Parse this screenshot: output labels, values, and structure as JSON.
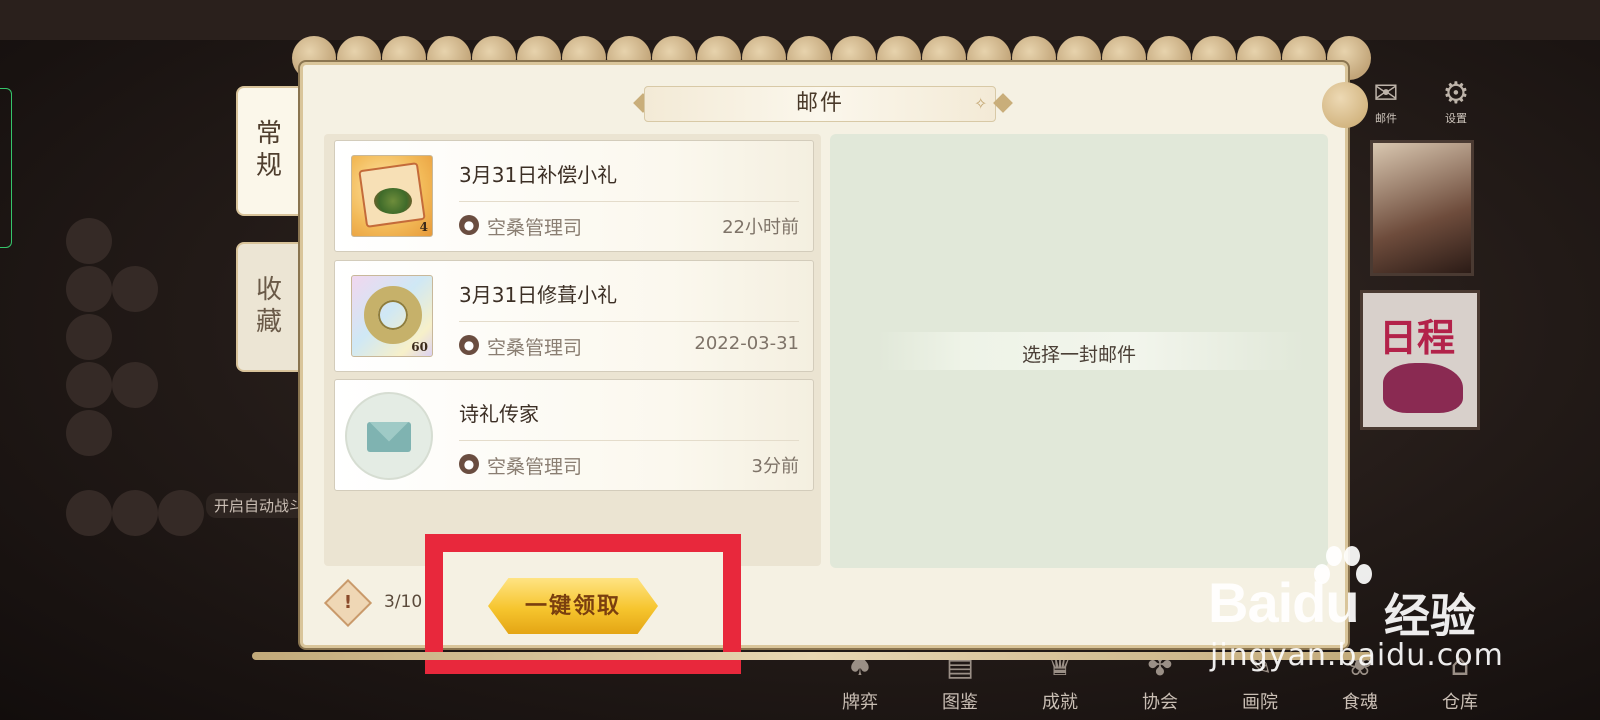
{
  "window": {
    "title": "邮件"
  },
  "tabs": [
    {
      "label": "常规",
      "active": true
    },
    {
      "label": "收藏",
      "active": false
    }
  ],
  "mails": [
    {
      "title": "3月31日补偿小礼",
      "sender": "空桑管理司",
      "time": "22小时前",
      "thumb": "gift-scroll-icon",
      "item_count": "4"
    },
    {
      "title": "3月31日修葺小礼",
      "sender": "空桑管理司",
      "time": "2022-03-31",
      "thumb": "jade-ring-icon",
      "item_count": "60"
    },
    {
      "title": "诗礼传家",
      "sender": "空桑管理司",
      "time": "3分前",
      "thumb": "envelope-icon",
      "item_count": ""
    }
  ],
  "detail": {
    "placeholder": "选择一封邮件"
  },
  "footer": {
    "mail_count": "3/10",
    "claim_all_label": "一键领取",
    "warning_icon": "!"
  },
  "background": {
    "top_icons": [
      {
        "label": "邮件",
        "icon": "mail-icon"
      },
      {
        "label": "设置",
        "icon": "gear-icon"
      }
    ],
    "side_label": "开启自动战斗",
    "poster_text": "日程",
    "bottom_nav": [
      "牌弈",
      "图鉴",
      "成就",
      "协会",
      "画院",
      "食魂",
      "仓库"
    ]
  },
  "watermark": {
    "logo": "Baidu",
    "product": "经验",
    "url": "jingyan.baidu.com"
  },
  "colors": {
    "highlight": "#e8283c",
    "claim_button": "#f6c52e",
    "panel_bg": "#f5f1e3",
    "detail_bg": "#e1e8d9"
  }
}
